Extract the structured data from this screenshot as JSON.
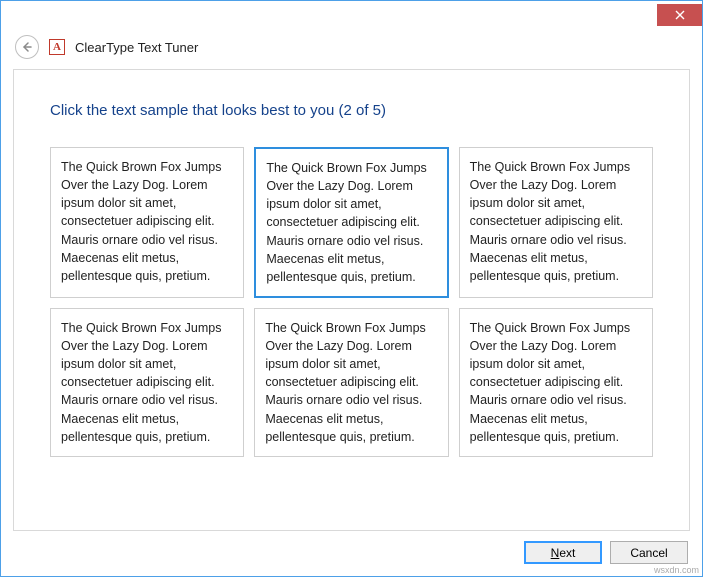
{
  "window": {
    "title": "ClearType Text Tuner"
  },
  "heading": "Click the text sample that looks best to you (2 of 5)",
  "sample_text": "The Quick Brown Fox Jumps Over the Lazy Dog. Lorem ipsum dolor sit amet, consectetuer adipiscing elit. Mauris ornare odio vel risus. Maecenas elit metus, pellentesque quis, pretium.",
  "samples": [
    {
      "selected": false
    },
    {
      "selected": true
    },
    {
      "selected": false
    },
    {
      "selected": false
    },
    {
      "selected": false
    },
    {
      "selected": false
    }
  ],
  "buttons": {
    "next": "Next",
    "cancel": "Cancel"
  },
  "watermark": "wsxdn.com"
}
